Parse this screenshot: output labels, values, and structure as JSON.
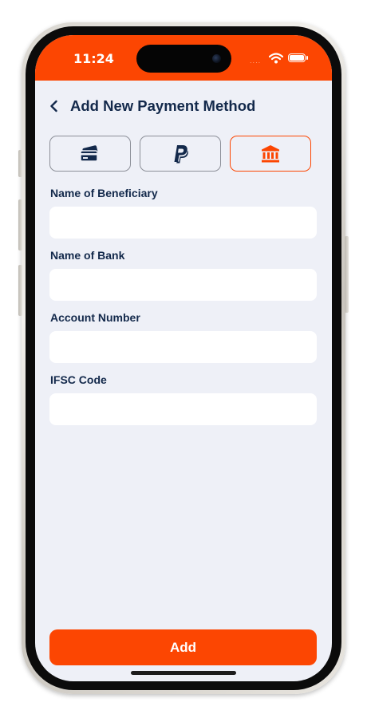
{
  "status_bar": {
    "time": "11:24",
    "signal": "....",
    "background_color": "#fc4602"
  },
  "header": {
    "back_icon": "chevron-left-icon",
    "title": "Add New Payment Method"
  },
  "payment_methods": [
    {
      "name": "card",
      "icon": "credit-card-icon",
      "selected": false
    },
    {
      "name": "paypal",
      "icon": "paypal-icon",
      "selected": false
    },
    {
      "name": "bank",
      "icon": "bank-icon",
      "selected": true
    }
  ],
  "form": {
    "fields": [
      {
        "label": "Name of Beneficiary",
        "value": "",
        "placeholder": ""
      },
      {
        "label": "Name of Bank",
        "value": "",
        "placeholder": ""
      },
      {
        "label": "Account Number",
        "value": "",
        "placeholder": ""
      },
      {
        "label": "IFSC Code",
        "value": "",
        "placeholder": ""
      }
    ]
  },
  "actions": {
    "add_label": "Add"
  },
  "colors": {
    "accent": "#fc4602",
    "text_primary": "#13294b",
    "background": "#eef0f7",
    "input_background": "#ffffff"
  }
}
